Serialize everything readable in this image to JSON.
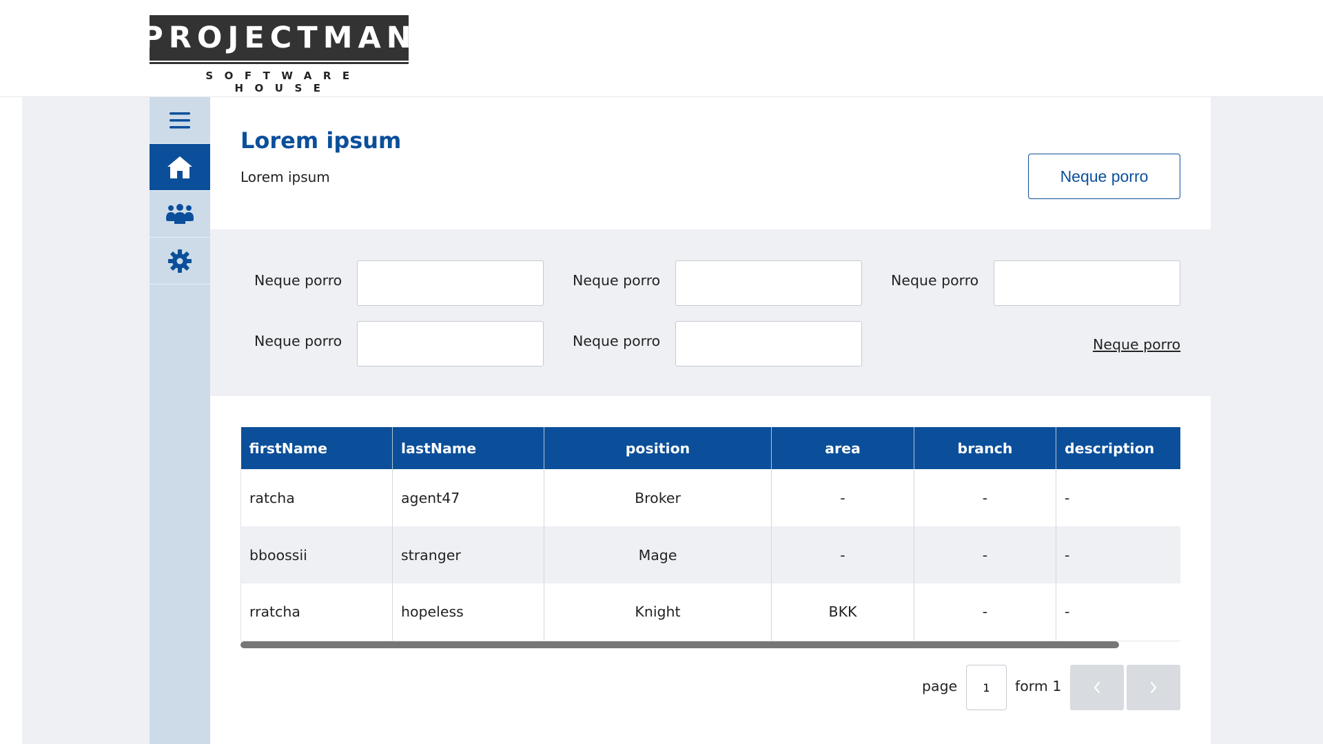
{
  "brand": {
    "logo_main": "PROJECTMAN",
    "logo_sub": "SOFTWARE HOUSE"
  },
  "sidebar": {
    "items": [
      {
        "icon": "menu-icon",
        "active": false
      },
      {
        "icon": "home-icon",
        "active": true
      },
      {
        "icon": "users-icon",
        "active": false
      },
      {
        "icon": "gear-icon",
        "active": false
      }
    ]
  },
  "page": {
    "title": "Lorem ipsum",
    "subtitle": "Lorem ipsum",
    "action_label": "Neque porro"
  },
  "filters": {
    "fields": [
      {
        "label": "Neque porro",
        "value": ""
      },
      {
        "label": "Neque porro",
        "value": ""
      },
      {
        "label": "Neque porro",
        "value": ""
      },
      {
        "label": "Neque porro",
        "value": ""
      },
      {
        "label": "Neque porro",
        "value": ""
      }
    ],
    "link_label": "Neque porro"
  },
  "table": {
    "columns": [
      "firstName",
      "lastName",
      "position",
      "area",
      "branch",
      "description"
    ],
    "rows": [
      [
        "ratcha",
        "agent47",
        "Broker",
        "-",
        "-",
        "-"
      ],
      [
        "bboossii",
        "stranger",
        "Mage",
        "-",
        "-",
        "-"
      ],
      [
        "rratcha",
        "hopeless",
        "Knight",
        "BKK",
        "-",
        "-"
      ]
    ]
  },
  "pagination": {
    "page_label": "page",
    "current_page": "1",
    "total_label": "form 1"
  },
  "colors": {
    "primary": "#0b4f9a",
    "sidebar_bg": "#cddbe9",
    "page_bg": "#eef0f4",
    "pager_button": "#d8dbe0",
    "scrollbar": "#767676"
  }
}
